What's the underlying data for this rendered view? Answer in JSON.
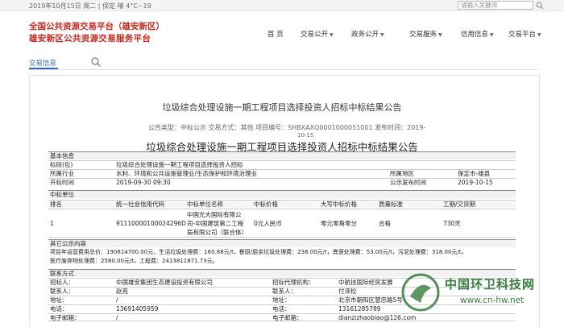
{
  "topbar": {
    "date": "2019年10月15日 周二 | 保定 晴 4°C~19",
    "search_placeholder": "请输入关键词"
  },
  "header": {
    "title_line1": "全国公共资源交易平台（雄安新区）",
    "title_line2": "雄安新区公共资源交易服务平台",
    "nav": [
      "首 页",
      "交易公开",
      "政务公开",
      "交易服务",
      "信用信息",
      "交易平台"
    ]
  },
  "subnav": {
    "label": "交易信息"
  },
  "article": {
    "title": "垃圾综合处理设施一期工程项目选择投资人招标中标结果公告",
    "meta": "公告类型：中标公示 交易方式：其他 项目编号：SHBXAXQ0001000051001 发布时间：2019-",
    "meta_tail": "10-15",
    "subtitle": "垃圾综合处理设施一期工程项目选择投资人招标中标结果公告"
  },
  "basic": {
    "section": "基本信息",
    "rows": [
      [
        "标段(包)",
        "垃圾综合处理设施一期工程项目选择投资人招标",
        "",
        ""
      ],
      [
        "所属行业",
        "水利、环境和公共设施管理业/生态保护和环境治理业",
        "所属地区",
        "保定市-雄县"
      ],
      [
        "开标时间",
        "2019-09-30 09:30",
        "公示发布时间",
        "2019-10-15"
      ]
    ]
  },
  "winner": {
    "section": "中标单位",
    "headers": [
      "排名",
      "统一社会信用代码",
      "中标单位名称",
      "中标价格",
      "大写中标价格",
      "质量标准",
      "工期/交货期"
    ],
    "row": [
      "1",
      "91110000100024296D",
      "中国光大国际有限公司-中国建筑第二工程局有限公司（联合体）",
      "0元人民币",
      "零元零角零分",
      "合格",
      "730天"
    ],
    "name_lines": [
      "中国光大国际有限公",
      "司-中国建筑第二工程",
      "局有限公司（联合体）"
    ]
  },
  "other": {
    "section": "其它公示内容",
    "lines": [
      "项目年运营费用总价：190814700.00元，生活垃圾处理费：160.88元/t，餐厨/厨余垃圾处理费：238.00元/t，粪便处理费：53.00元/t，污泥处理费：318.00元/t，",
      "医疗废弃物处理费：2580.00元/t，工程费：2413811871.73元。"
    ]
  },
  "contact": {
    "section": "联系方式",
    "rows": [
      [
        "招标人：",
        "中国雄安集团生态建设投资有限公司",
        "招标代理机构：",
        "中航技国际经贸发展"
      ],
      [
        "联系人：",
        "赵亮",
        "联系人：",
        "付泽松"
      ],
      [
        "地址：",
        "/",
        "地址：",
        "北京市朝阳区慧忠路5号"
      ],
      [
        "电话：",
        "13691405959",
        "电话：",
        "13161285789"
      ],
      [
        "电子邮箱：",
        "/",
        "电子邮箱：",
        "dianzizhaobiao@126.com"
      ]
    ]
  },
  "watermark": {
    "cn": "中国环卫科技网",
    "en": "www.cn-hw.net"
  },
  "colors": {
    "brand_red": "#c9281d",
    "link_blue": "#2a6fb7",
    "watermark_green": "#3a7d3f"
  }
}
